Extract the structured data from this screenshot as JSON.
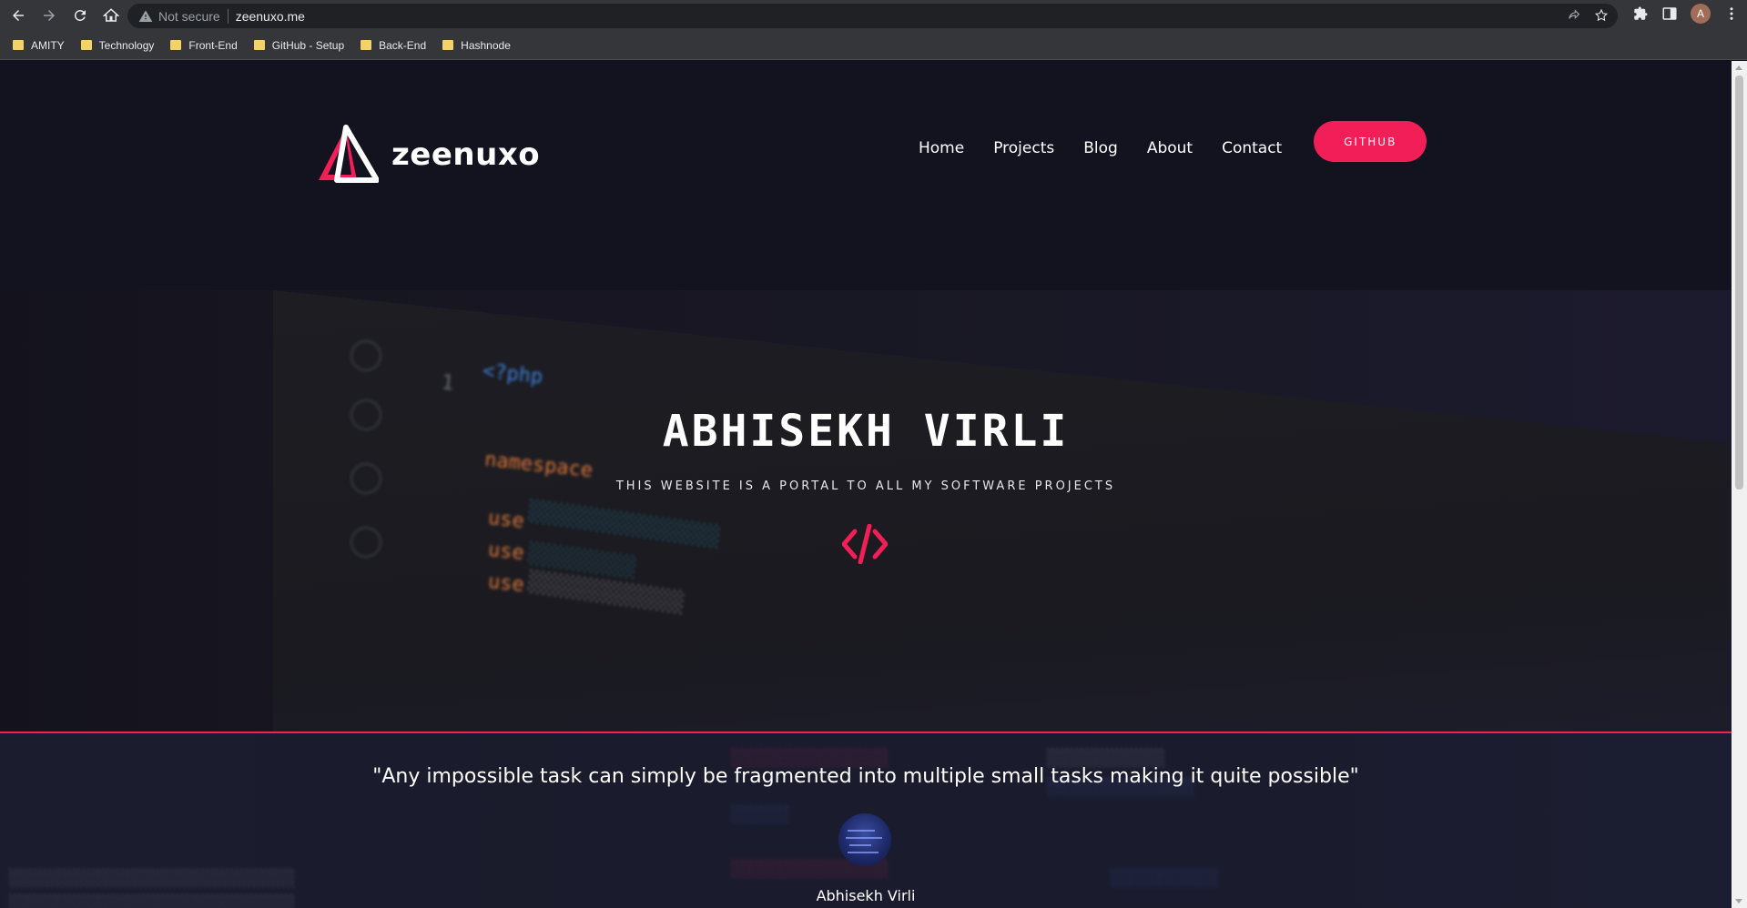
{
  "browser": {
    "security_label": "Not secure",
    "url": "zeenuxo.me",
    "profile_initial": "A",
    "bookmarks": [
      "AMITY",
      "Technology",
      "Front-End",
      "GitHub - Setup",
      "Back-End",
      "Hashnode"
    ]
  },
  "site": {
    "logo_text": "zeenuxo",
    "nav": [
      "Home",
      "Projects",
      "Blog",
      "About",
      "Contact"
    ],
    "github_label": "GITHUB",
    "hero_title": "ABHISEKH VIRLI",
    "hero_subtitle": "THIS WEBSITE IS A PORTAL TO ALL MY SOFTWARE PROJECTS",
    "quote": "\"Any impossible task can simply be fragmented into multiple small tasks making it quite possible\"",
    "author": "Abhisekh Virli"
  },
  "colors": {
    "accent": "#f21e57",
    "background": "#13121f"
  },
  "icons": {
    "hero": "code-icon",
    "logo": "triangle-logo-icon"
  }
}
